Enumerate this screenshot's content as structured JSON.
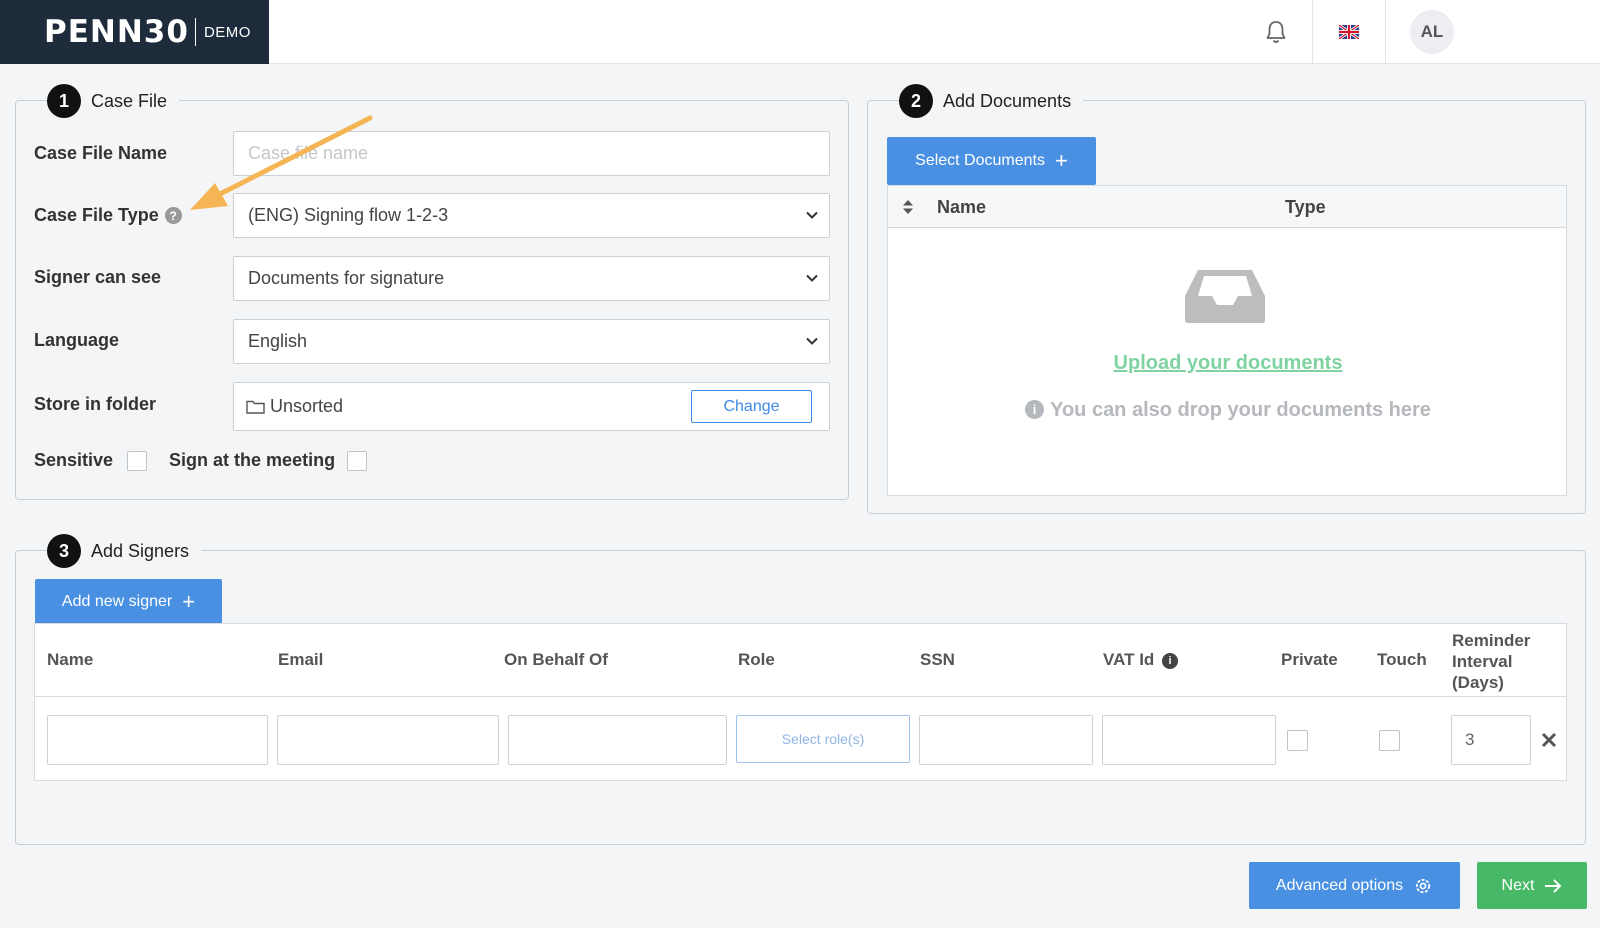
{
  "header": {
    "logo_text": "PENN30",
    "logo_tag": "DEMO",
    "avatar_initials": "AL",
    "icons": [
      "bell-icon",
      "uk-flag-icon"
    ]
  },
  "case_file": {
    "number": "1",
    "title": "Case File",
    "name_label": "Case File Name",
    "name_placeholder": "Case file name",
    "type_label": "Case File Type",
    "type_value": "(ENG) Signing flow 1-2-3",
    "signer_label": "Signer can see",
    "signer_value": "Documents for signature",
    "language_label": "Language",
    "language_value": "English",
    "folder_label": "Store in folder",
    "folder_value": "Unsorted",
    "change_label": "Change",
    "sensitive_label": "Sensitive",
    "meeting_label": "Sign at the meeting"
  },
  "documents": {
    "number": "2",
    "title": "Add Documents",
    "select_label": "Select Documents",
    "col_name": "Name",
    "col_type": "Type",
    "upload_link": "Upload your documents",
    "drop_hint": "You can also drop your documents here"
  },
  "signers": {
    "number": "3",
    "title": "Add Signers",
    "add_label": "Add new signer",
    "columns": {
      "name": "Name",
      "email": "Email",
      "behalf": "On Behalf Of",
      "role": "Role",
      "ssn": "SSN",
      "vat": "VAT Id",
      "private": "Private",
      "touch": "Touch",
      "reminder_1": "Reminder",
      "reminder_2": "Interval",
      "reminder_3": "(Days)"
    },
    "role_placeholder": "Select role(s)",
    "reminder_value": "3"
  },
  "footer": {
    "advanced_label": "Advanced options",
    "next_label": "Next"
  },
  "colors": {
    "primary": "#4a90e2",
    "success": "#47b865",
    "logo_bg": "#1d2b3a",
    "annotation_arrow": "#f5b555"
  }
}
